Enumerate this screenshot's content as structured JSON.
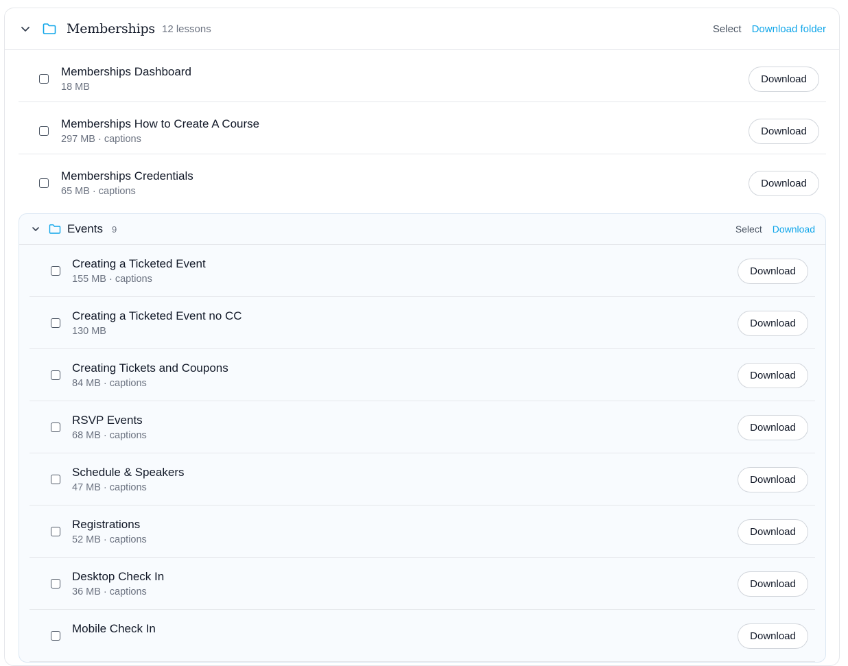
{
  "folder": {
    "title": "Memberships",
    "count": "12 lessons",
    "select_label": "Select",
    "download_label": "Download folder"
  },
  "lessons": [
    {
      "title": "Memberships Dashboard",
      "meta": "18 MB",
      "button": "Download"
    },
    {
      "title": "Memberships How to Create A Course",
      "meta": "297 MB · captions",
      "button": "Download"
    },
    {
      "title": "Memberships Credentials",
      "meta": "65 MB · captions",
      "button": "Download"
    }
  ],
  "subfolder": {
    "title": "Events",
    "count": "9",
    "select_label": "Select",
    "download_label": "Download",
    "lessons": [
      {
        "title": "Creating a Ticketed Event",
        "meta": "155 MB · captions",
        "button": "Download"
      },
      {
        "title": "Creating a Ticketed Event no CC",
        "meta": "130 MB",
        "button": "Download"
      },
      {
        "title": "Creating Tickets and Coupons",
        "meta": "84 MB · captions",
        "button": "Download"
      },
      {
        "title": "RSVP Events",
        "meta": "68 MB · captions",
        "button": "Download"
      },
      {
        "title": "Schedule & Speakers",
        "meta": "47 MB · captions",
        "button": "Download"
      },
      {
        "title": "Registrations",
        "meta": "52 MB · captions",
        "button": "Download"
      },
      {
        "title": "Desktop Check In",
        "meta": "36 MB · captions",
        "button": "Download"
      },
      {
        "title": "Mobile Check In",
        "meta": "",
        "button": "Download"
      }
    ]
  },
  "colors": {
    "accent": "#0ea5e9",
    "border": "#e5e7eb",
    "muted_text": "#6b7280"
  }
}
